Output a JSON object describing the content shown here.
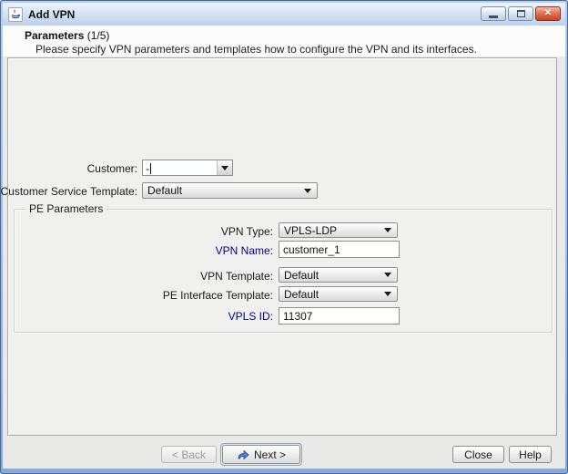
{
  "window": {
    "title": "Add VPN",
    "controls": {
      "minimize": "minimize-icon",
      "maximize": "maximize-icon",
      "close": "close-icon",
      "app_icon": "java-icon"
    }
  },
  "header": {
    "title": "Parameters",
    "step": "(1/5)",
    "description": "Please specify VPN parameters and templates how to configure the VPN and its interfaces."
  },
  "form": {
    "customer": {
      "label": "Customer:",
      "value": "-"
    },
    "customer_service_template": {
      "label": "Customer Service Template:",
      "value": "Default"
    },
    "pe_parameters": {
      "title": "PE Parameters",
      "vpn_type": {
        "label": "VPN Type:",
        "value": "VPLS-LDP"
      },
      "vpn_name": {
        "label": "VPN Name:",
        "value": "customer_1"
      },
      "vpn_template": {
        "label": "VPN Template:",
        "value": "Default"
      },
      "pe_interface_template": {
        "label": "PE Interface Template:",
        "value": "Default"
      },
      "vpls_id": {
        "label": "VPLS ID:",
        "value": "11307"
      }
    }
  },
  "buttons": {
    "back": "< Back",
    "next": "Next >",
    "close": "Close",
    "help": "Help"
  },
  "colors": {
    "frame": "#476b9e",
    "titlebar_top": "#eef5fd",
    "titlebar_bottom": "#bcd2ec",
    "close_button": "#cb4526",
    "panel_bg": "#f0f0ee",
    "required_label": "#00008b",
    "next_icon_blue": "#3f6cc4"
  }
}
